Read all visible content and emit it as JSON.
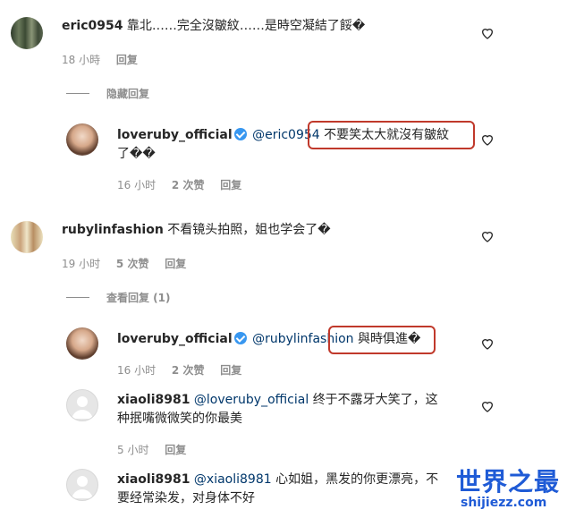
{
  "comments": [
    {
      "username": "eric0954",
      "text": "靠北……完全沒皺紋……是時空凝結了餒�️",
      "time": "18 小時",
      "reply": "回复"
    },
    {
      "username": "loveruby_official",
      "mention": "@eric0954",
      "text_line1": "不要笑太大就沒有皺紋",
      "text_line2": "了��",
      "time": "16 小时",
      "likes": "2 次赞",
      "reply": "回复"
    },
    {
      "username": "rubylinfashion",
      "text": "不看镜头拍照，姐也学会了�",
      "time": "19 小时",
      "likes": "5 次赞",
      "reply": "回复"
    },
    {
      "username": "loveruby_official",
      "mention": "@rubylinfashion",
      "text": "與時俱進�",
      "time": "16 小时",
      "likes": "2 次赞",
      "reply": "回复"
    },
    {
      "username": "xiaoli8981",
      "mention": "@loveruby_official",
      "text_line1": "终于不露牙大笑了，这",
      "text_line2": "种抿嘴微微笑的你最美",
      "time": "5 小时",
      "reply": "回复"
    },
    {
      "username": "xiaoli8981",
      "mention": "@xiaoli8981",
      "text_line1": "心如姐，黑发的你更漂亮，不",
      "text_line2": "要经常染发，对身体不好"
    }
  ],
  "hide_replies": "隐藏回复",
  "view_replies": "查看回复 (1)",
  "watermark": {
    "cn": "世界之最",
    "en": "shijiezz.com"
  },
  "colors": {
    "text": "#262626",
    "meta": "#8e8e8e",
    "highlight_box": "#c0392b",
    "watermark": "#1f5bd6"
  }
}
